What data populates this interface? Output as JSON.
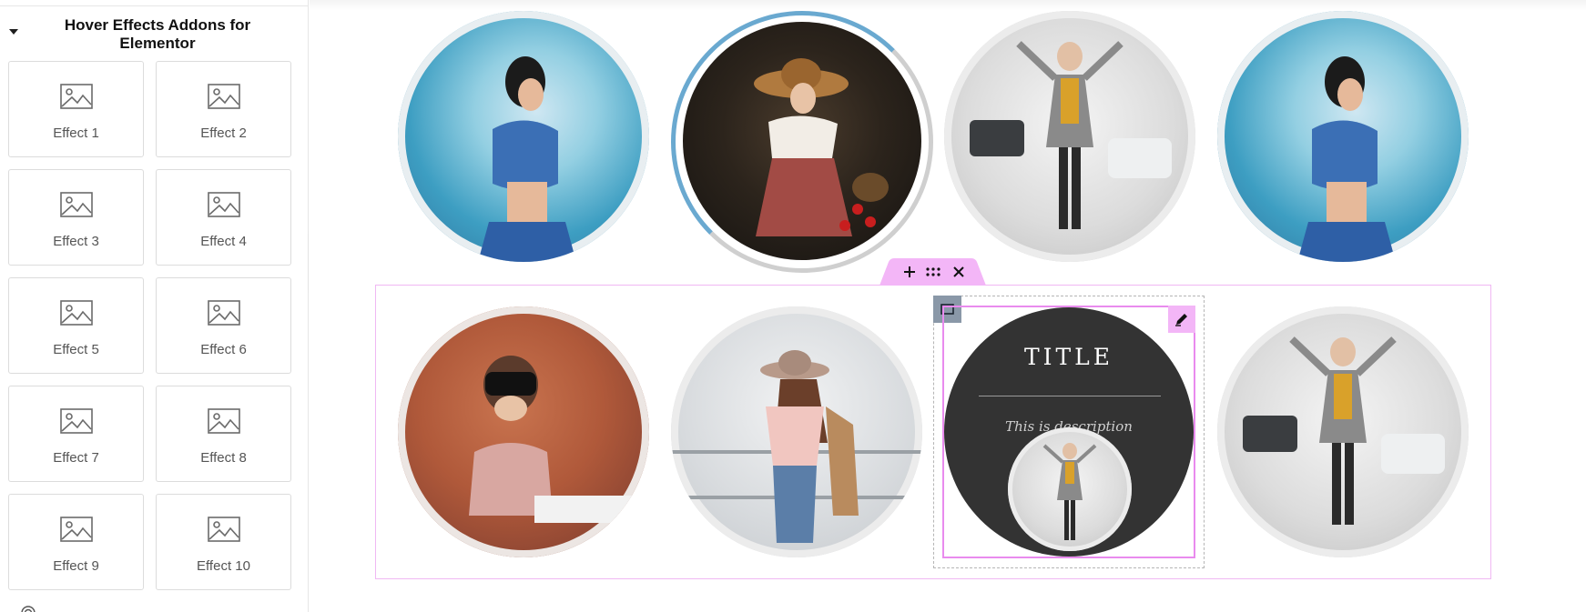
{
  "sidebar": {
    "category_title": "Hover Effects Addons for Elementor",
    "widgets": [
      {
        "label": "Effect 1"
      },
      {
        "label": "Effect 2"
      },
      {
        "label": "Effect 3"
      },
      {
        "label": "Effect 4"
      },
      {
        "label": "Effect 5"
      },
      {
        "label": "Effect 6"
      },
      {
        "label": "Effect 7"
      },
      {
        "label": "Effect 8"
      },
      {
        "label": "Effect 9"
      },
      {
        "label": "Effect 10"
      }
    ]
  },
  "canvas": {
    "row1_images": [
      "beach-woman-photo",
      "woman-with-apple-photo",
      "woman-in-snow-photo",
      "beach-woman-photo"
    ],
    "row2_images": [
      "woman-vr-headset-photo",
      "woman-with-hat-photo",
      "hover-overlay-card",
      "woman-in-snow-photo"
    ],
    "hover_card": {
      "title": "TITLE",
      "description": "This is description"
    },
    "section_toolbar": {
      "add_icon": "plus-icon",
      "drag_icon": "drag-handle-icon",
      "close_icon": "close-icon"
    }
  },
  "colors": {
    "editor_accent": "#f3b6f7",
    "outline_pink": "#f0b8f3",
    "ring_blue": "#6aa9d0",
    "overlay_dark": "#333333"
  }
}
